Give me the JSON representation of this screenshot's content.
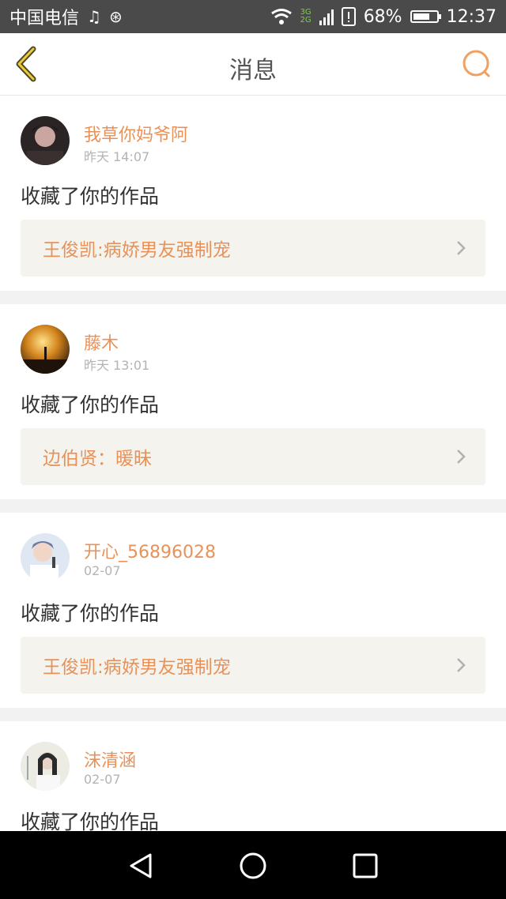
{
  "statusbar": {
    "carrier": "中国电信",
    "network_top": "3G",
    "network_bottom": "2G",
    "battery": "68%",
    "time": "12:37"
  },
  "navbar": {
    "title": "消息",
    "accent_color": "#e8925a"
  },
  "messages": [
    {
      "username": "我草你妈爷阿",
      "time": "昨天 14:07",
      "action": "收藏了你的作品",
      "work": "王俊凯:病娇男友强制宠",
      "avatar_color": "#2b2424"
    },
    {
      "username": "藤木",
      "time": "昨天 13:01",
      "action": "收藏了你的作品",
      "work": "边伯贤：暖昧",
      "avatar_color": "#a8651c"
    },
    {
      "username": "开心_56896028",
      "time": "02-07",
      "action": "收藏了你的作品",
      "work": "王俊凯:病娇男友强制宠",
      "avatar_color": "#cfd9e6"
    },
    {
      "username": "沫清涵",
      "time": "02-07",
      "action": "收藏了你的作品",
      "work": "",
      "avatar_color": "#e6e4dc"
    }
  ]
}
